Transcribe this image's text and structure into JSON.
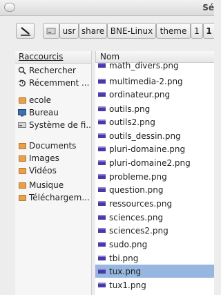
{
  "window": {
    "title": "Sé"
  },
  "toolbar": {
    "path_buttons": [
      "usr",
      "share",
      "BNE-Linux",
      "theme",
      "1",
      "1"
    ]
  },
  "sidebar": {
    "header": "Raccourcis",
    "items": [
      {
        "label": "Rechercher",
        "icon": "search-icon"
      },
      {
        "label": "Récemment ...",
        "icon": "recent-icon"
      },
      {
        "label": "ecole",
        "icon": "home-folder-icon"
      },
      {
        "label": "Bureau",
        "icon": "desktop-icon"
      },
      {
        "label": "Système de fi...",
        "icon": "drive-icon"
      },
      {
        "label": "Documents",
        "icon": "documents-folder-icon"
      },
      {
        "label": "Images",
        "icon": "pictures-folder-icon"
      },
      {
        "label": "Vidéos",
        "icon": "videos-folder-icon"
      },
      {
        "label": "Musique",
        "icon": "music-folder-icon"
      },
      {
        "label": "Téléchargem...",
        "icon": "downloads-folder-icon"
      }
    ]
  },
  "files": {
    "column_header": "Nom",
    "rows": [
      "math_divers.png",
      "multimedia-2.png",
      "ordinateur.png",
      "outils.png",
      "outils2.png",
      "outils_dessin.png",
      "pluri-domaine.png",
      "pluri-domaine2.png",
      "probleme.png",
      "question.png",
      "ressources.png",
      "sciences.png",
      "sciences2.png",
      "sudo.png",
      "tbi.png",
      "tux.png",
      "tux1.png"
    ],
    "selected": "tux.png"
  }
}
